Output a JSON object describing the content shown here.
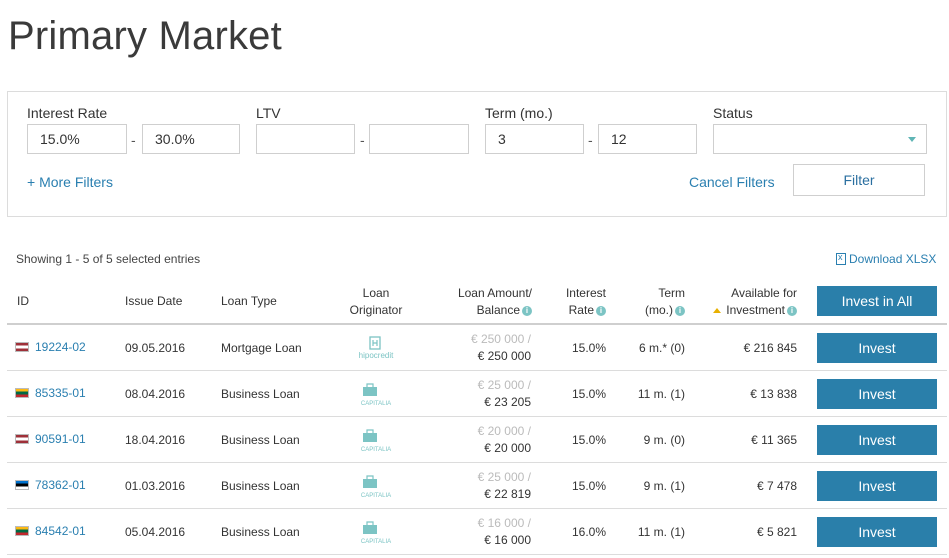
{
  "page": {
    "title": "Primary Market"
  },
  "filters": {
    "interest_rate": {
      "label": "Interest Rate",
      "min": "15.0%",
      "max": "30.0%"
    },
    "ltv": {
      "label": "LTV",
      "min": "",
      "max": ""
    },
    "term": {
      "label": "Term (mo.)",
      "min": "3",
      "max": "12"
    },
    "status": {
      "label": "Status",
      "value": ""
    },
    "dash": "-",
    "more_filters": "+ More Filters",
    "cancel_filters": "Cancel Filters",
    "filter_button": "Filter"
  },
  "table_info": {
    "showing": "Showing 1 - 5 of 5 selected entries",
    "download": "Download XLSX"
  },
  "columns": {
    "id": "ID",
    "issue_date": "Issue Date",
    "loan_type": "Loan Type",
    "originator_1": "Loan",
    "originator_2": "Originator",
    "amount_1": "Loan Amount/",
    "amount_2": "Balance",
    "rate_1": "Interest",
    "rate_2": "Rate",
    "term_1": "Term",
    "term_2": "(mo.)",
    "available_1": "Available for",
    "available_2": "Investment",
    "invest_all": "Invest in All",
    "info_glyph": "i"
  },
  "originators": {
    "hipo": "hipocredit",
    "capitalia": "CAPITALIA"
  },
  "rows": [
    {
      "flag": "lv",
      "id": "19224-02",
      "issue_date": "09.05.2016",
      "loan_type": "Mortgage Loan",
      "originator": "hipocredit",
      "amount": "€ 250 000 /",
      "balance": "€ 250 000",
      "rate": "15.0%",
      "term": "6 m.* (0)",
      "available": "€ 216 845",
      "action": "Invest"
    },
    {
      "flag": "lt",
      "id": "85335-01",
      "issue_date": "08.04.2016",
      "loan_type": "Business Loan",
      "originator": "CAPITALIA",
      "amount": "€ 25 000 /",
      "balance": "€ 23 205",
      "rate": "15.0%",
      "term": "11 m. (1)",
      "available": "€ 13 838",
      "action": "Invest"
    },
    {
      "flag": "lv",
      "id": "90591-01",
      "issue_date": "18.04.2016",
      "loan_type": "Business Loan",
      "originator": "CAPITALIA",
      "amount": "€ 20 000 /",
      "balance": "€ 20 000",
      "rate": "15.0%",
      "term": "9 m. (0)",
      "available": "€ 11 365",
      "action": "Invest"
    },
    {
      "flag": "ee",
      "id": "78362-01",
      "issue_date": "01.03.2016",
      "loan_type": "Business Loan",
      "originator": "CAPITALIA",
      "amount": "€ 25 000 /",
      "balance": "€ 22 819",
      "rate": "15.0%",
      "term": "9 m. (1)",
      "available": "€ 7 478",
      "action": "Invest"
    },
    {
      "flag": "lt",
      "id": "84542-01",
      "issue_date": "05.04.2016",
      "loan_type": "Business Loan",
      "originator": "CAPITALIA",
      "amount": "€ 16 000 /",
      "balance": "€ 16 000",
      "rate": "16.0%",
      "term": "11 m. (1)",
      "available": "€ 5 821",
      "action": "Invest"
    }
  ],
  "colors": {
    "accent": "#2a7faa",
    "link": "#2a7fb0",
    "teal": "#7cc4c4",
    "sort": "#e8b000"
  },
  "flags": {
    "lv": [
      "#9e3039",
      "#ffffff",
      "#9e3039"
    ],
    "lt": [
      "#fdb913",
      "#006a44",
      "#c1272d"
    ],
    "ee": [
      "#0072ce",
      "#000000",
      "#ffffff"
    ]
  }
}
